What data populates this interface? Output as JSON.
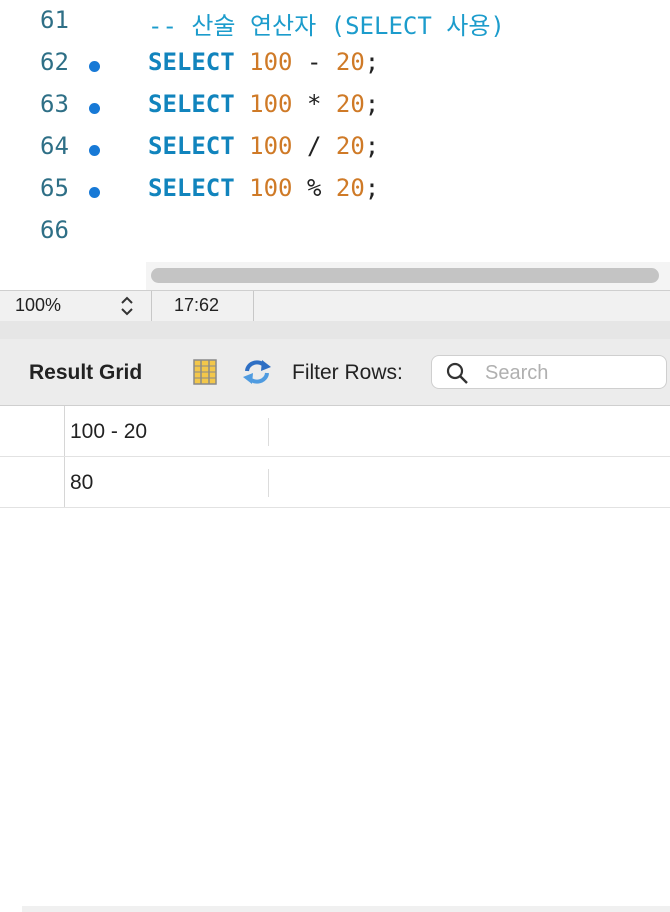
{
  "editor": {
    "lines": [
      {
        "num": "61",
        "bp": false,
        "comment": "-- 산술 연산자 (SELECT 사용)"
      },
      {
        "num": "62",
        "bp": true,
        "kw": "SELECT",
        "n1": "100",
        "op": "-",
        "n2": "20",
        "semi": ";"
      },
      {
        "num": "63",
        "bp": true,
        "kw": "SELECT",
        "n1": "100",
        "op": "*",
        "n2": "20",
        "semi": ";"
      },
      {
        "num": "64",
        "bp": true,
        "kw": "SELECT",
        "n1": "100",
        "op": "/",
        "n2": "20",
        "semi": ";"
      },
      {
        "num": "65",
        "bp": true,
        "kw": "SELECT",
        "n1": "100",
        "op": "%",
        "n2": "20",
        "semi": ";"
      },
      {
        "num": "66",
        "bp": false
      }
    ]
  },
  "status": {
    "zoom": "100%",
    "cursor": "17:62"
  },
  "toolbar": {
    "result_grid_label": "Result Grid",
    "filter_label": "Filter Rows:",
    "search_placeholder": "Search",
    "grid_icon": "grid-view-icon",
    "refresh_icon": "refresh-icon",
    "search_icon": "search-icon"
  },
  "result": {
    "header": "100 - 20",
    "value": "80"
  },
  "colors": {
    "keyword": "#1184bd",
    "number": "#cf7a27",
    "comment": "#1c9ccc",
    "line_number": "#2e6f86",
    "breakpoint": "#1779d6"
  }
}
